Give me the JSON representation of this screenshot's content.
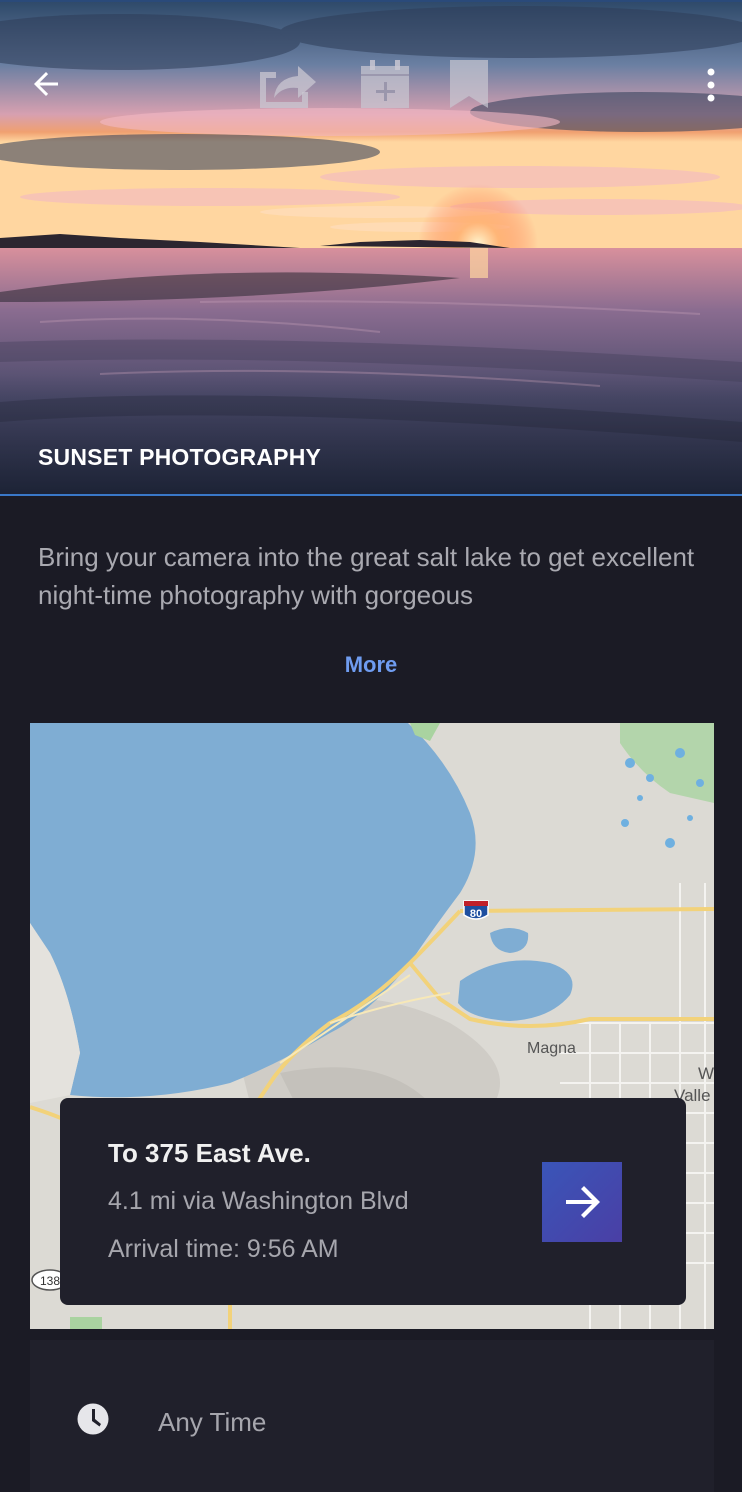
{
  "hero": {
    "title": "SUNSET PHOTOGRAPHY",
    "icons": [
      "back-arrow-icon",
      "share-icon",
      "add-to-calendar-icon",
      "bookmark-icon",
      "more-vert-icon"
    ]
  },
  "description": {
    "text": "Bring your camera into the great salt lake to get excellent night-time photography with gorgeous",
    "more_label": "More"
  },
  "map": {
    "labels": {
      "interstate": "80",
      "magna": "Magna",
      "west_valley_1": "W",
      "west_valley_2": "Valle",
      "route_marker": "138"
    }
  },
  "route": {
    "title": "To 375 East Ave.",
    "distance": "4.1 mi via Washington Blvd",
    "arrival": "Arrival time: 9:56 AM",
    "go_icon": "arrow-right-icon"
  },
  "schedule": {
    "icon": "clock-icon",
    "label": "Any Time"
  },
  "colors": {
    "background": "#1b1b25",
    "card": "#20202b",
    "accent_link": "#6f9cf0",
    "button": "#3a55b8",
    "water": "#7fadd3"
  }
}
